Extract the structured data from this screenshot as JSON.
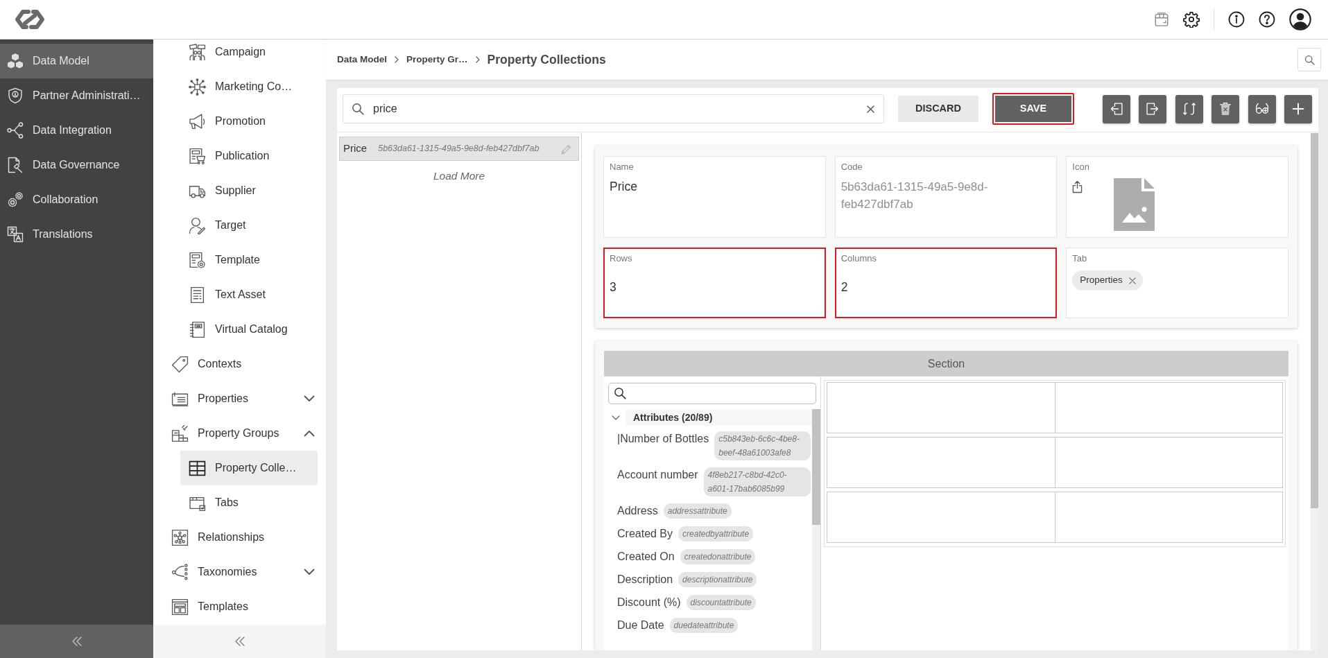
{
  "main_nav": {
    "items": [
      {
        "label": "Data Model",
        "selected": true
      },
      {
        "label": "Partner Administrati…",
        "selected": false
      },
      {
        "label": "Data Integration",
        "selected": false
      },
      {
        "label": "Data Governance",
        "selected": false
      },
      {
        "label": "Collaboration",
        "selected": false
      },
      {
        "label": "Translations",
        "selected": false
      }
    ]
  },
  "sub_nav": {
    "items": [
      {
        "children": [
          {
            "label": "Campaign",
            "selected": false
          },
          {
            "label": "Marketing Co…",
            "selected": false
          },
          {
            "label": "Promotion",
            "selected": false
          },
          {
            "label": "Publication",
            "selected": false
          },
          {
            "label": "Supplier",
            "selected": false
          },
          {
            "label": "Target",
            "selected": false
          },
          {
            "label": "Template",
            "selected": false
          },
          {
            "label": "Text Asset",
            "selected": false
          },
          {
            "label": "Virtual Catalog",
            "selected": false
          }
        ]
      },
      {
        "label": "Contexts",
        "selected": false
      },
      {
        "label": "Properties",
        "selected": false,
        "expanded": false
      },
      {
        "label": "Property Groups",
        "selected": false,
        "expanded": true,
        "children": [
          {
            "label": "Property Colle…",
            "selected": true
          },
          {
            "label": "Tabs",
            "selected": false
          }
        ]
      },
      {
        "label": "Relationships",
        "selected": false
      },
      {
        "label": "Taxonomies",
        "selected": false,
        "expanded": false
      },
      {
        "label": "Templates",
        "selected": false
      }
    ]
  },
  "breadcrumb": {
    "links": [
      "Data Model",
      "Property Gr…"
    ],
    "current": "Property Collections"
  },
  "toolbar": {
    "search": {
      "value": "price"
    },
    "buttons": [
      {
        "label": "DISCARD",
        "kind": "secondary",
        "highlighted": false
      },
      {
        "label": "SAVE",
        "kind": "primary",
        "highlighted": true
      }
    ]
  },
  "list": {
    "items": [
      {
        "name": "Price",
        "code": "5b63da61-1315-49a5-9e8d-feb427dbf7ab",
        "selected": true
      }
    ],
    "load_more": "Load More"
  },
  "form": {
    "fields": [
      {
        "kind": "text",
        "label": "Name",
        "value": "Price",
        "highlighted": false
      },
      {
        "kind": "code",
        "label": "Code",
        "value": "5b63da61-1315-49a5-9e8d-feb427dbf7ab",
        "highlighted": false
      },
      {
        "kind": "image",
        "label": "Icon",
        "highlighted": false
      },
      {
        "kind": "number",
        "label": "Rows",
        "value": "3",
        "highlighted": true
      },
      {
        "kind": "number",
        "label": "Columns",
        "value": "2",
        "highlighted": true
      },
      {
        "kind": "tags",
        "label": "Tab",
        "tags": [
          "Properties"
        ],
        "highlighted": false
      }
    ]
  },
  "section": {
    "title": "Section",
    "groups": [
      {
        "label": "Attributes (20/89)",
        "expanded": true,
        "items": [
          {
            "name": "|Number of Bottles",
            "code": "c5b843eb-6c6c-4be8-beef-48a61003afe8"
          },
          {
            "name": "Account number",
            "code": "4f8eb217-c8bd-42c0-a601-17bab6085b99"
          },
          {
            "name": "Address",
            "code": "addressattribute"
          },
          {
            "name": "Created By",
            "code": "createdbyattribute"
          },
          {
            "name": "Created On",
            "code": "createdonattribute"
          },
          {
            "name": "Description",
            "code": "descriptionattribute"
          },
          {
            "name": "Discount (%)",
            "code": "discountattribute"
          },
          {
            "name": "Due Date",
            "code": "duedateattribute"
          }
        ]
      }
    ]
  }
}
